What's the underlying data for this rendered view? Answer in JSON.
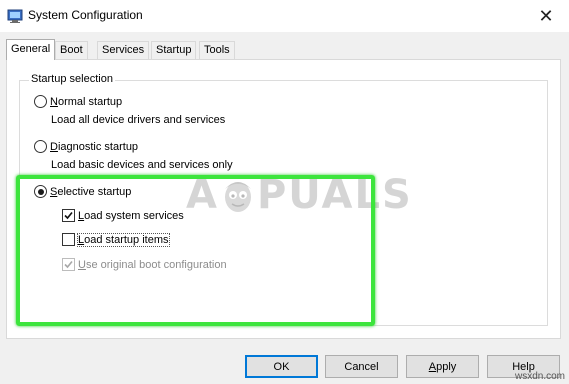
{
  "window": {
    "title": "System Configuration",
    "close_glyph": "✕"
  },
  "tabs": [
    {
      "label": "General",
      "active": true
    },
    {
      "label": "Boot",
      "active": false
    },
    {
      "label": "Services",
      "active": false
    },
    {
      "label": "Startup",
      "active": false
    },
    {
      "label": "Tools",
      "active": false
    }
  ],
  "startup_selection": {
    "legend": "Startup selection",
    "normal": {
      "label_prefix": "",
      "label_mnemonic": "N",
      "label_rest": "ormal startup",
      "description": "Load all device drivers and services",
      "selected": false
    },
    "diagnostic": {
      "label_prefix": "",
      "label_mnemonic": "D",
      "label_rest": "iagnostic startup",
      "description": "Load basic devices and services only",
      "selected": false
    },
    "selective": {
      "label_prefix": "",
      "label_mnemonic": "S",
      "label_rest": "elective startup",
      "selected": true,
      "options": {
        "load_system_services": {
          "label_mnemonic": "L",
          "label_rest": "oad system services",
          "checked": true
        },
        "load_startup_items": {
          "label_mnemonic": "L",
          "label_rest": "oad startup items",
          "checked": false
        },
        "use_original_boot": {
          "label_mnemonic": "U",
          "label_rest": "se original boot configuration",
          "checked": true,
          "disabled": true
        }
      }
    }
  },
  "watermark": {
    "text_a": "A",
    "text_rest": "PUALS",
    "icon": "mascot-face-icon"
  },
  "buttons": {
    "ok": "OK",
    "cancel": "Cancel",
    "apply_mnemonic": "A",
    "apply_rest": "pply",
    "help": "Help"
  },
  "site_mark": "wsxdn.com",
  "colors": {
    "highlight": "#3de53d",
    "accent": "#0078d7"
  }
}
